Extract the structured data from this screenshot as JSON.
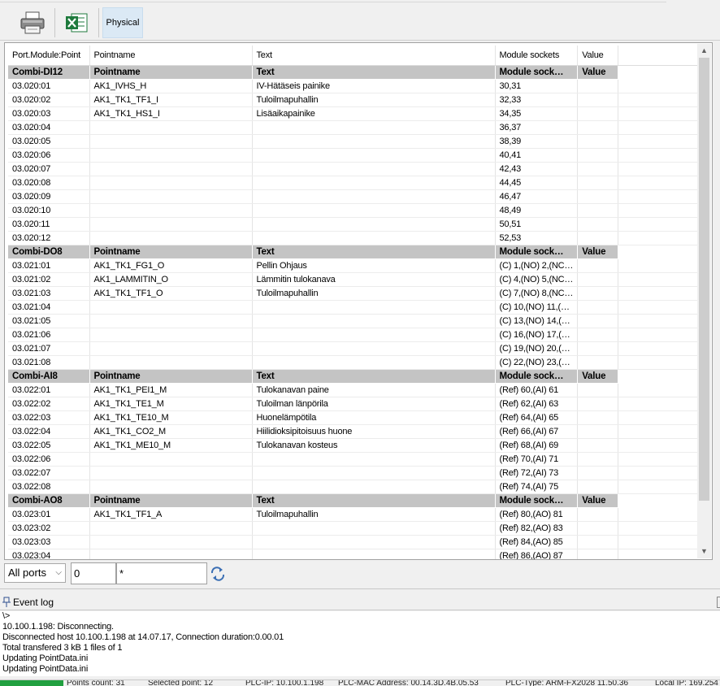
{
  "toolbar": {
    "physical_label": "Physical"
  },
  "grid": {
    "headers": [
      "Port.Module:Point",
      "Pointname",
      "Text",
      "Module sockets",
      "Value"
    ],
    "rows": [
      {
        "g": 1,
        "c": [
          "Combi-DI12",
          "Pointname",
          "Text",
          "Module sock…",
          "Value"
        ]
      },
      {
        "c": [
          "03.020:01",
          "AK1_IVHS_H",
          "IV-Hätäseis painike",
          "30,31",
          ""
        ]
      },
      {
        "c": [
          "03.020:02",
          "AK1_TK1_TF1_I",
          "Tuloilmapuhallin",
          "32,33",
          ""
        ]
      },
      {
        "c": [
          "03.020:03",
          "AK1_TK1_HS1_I",
          "Lisäaikapainike",
          "34,35",
          ""
        ]
      },
      {
        "c": [
          "03.020:04",
          "",
          "",
          "36,37",
          ""
        ]
      },
      {
        "c": [
          "03.020:05",
          "",
          "",
          "38,39",
          ""
        ]
      },
      {
        "c": [
          "03.020:06",
          "",
          "",
          "40,41",
          ""
        ]
      },
      {
        "c": [
          "03.020:07",
          "",
          "",
          "42,43",
          ""
        ]
      },
      {
        "c": [
          "03.020:08",
          "",
          "",
          "44,45",
          ""
        ]
      },
      {
        "c": [
          "03.020:09",
          "",
          "",
          "46,47",
          ""
        ]
      },
      {
        "c": [
          "03.020:10",
          "",
          "",
          "48,49",
          ""
        ]
      },
      {
        "c": [
          "03.020:11",
          "",
          "",
          "50,51",
          ""
        ]
      },
      {
        "c": [
          "03.020:12",
          "",
          "",
          "52,53",
          ""
        ]
      },
      {
        "g": 1,
        "c": [
          "Combi-DO8",
          "Pointname",
          "Text",
          "Module sock…",
          "Value"
        ]
      },
      {
        "c": [
          "03.021:01",
          "AK1_TK1_FG1_O",
          "Pellin Ohjaus",
          "(C) 1,(NO) 2,(NC…",
          ""
        ]
      },
      {
        "c": [
          "03.021:02",
          "AK1_LAMMITIN_O",
          "Lämmitin tulokanava",
          "(C) 4,(NO) 5,(NC…",
          ""
        ]
      },
      {
        "c": [
          "03.021:03",
          "AK1_TK1_TF1_O",
          "Tuloilmapuhallin",
          "(C) 7,(NO) 8,(NC…",
          ""
        ]
      },
      {
        "c": [
          "03.021:04",
          "",
          "",
          "(C) 10,(NO) 11,(…",
          ""
        ]
      },
      {
        "c": [
          "03.021:05",
          "",
          "",
          "(C) 13,(NO) 14,(…",
          ""
        ]
      },
      {
        "c": [
          "03.021:06",
          "",
          "",
          "(C) 16,(NO) 17,(…",
          ""
        ]
      },
      {
        "c": [
          "03.021:07",
          "",
          "",
          "(C) 19,(NO) 20,(…",
          ""
        ]
      },
      {
        "c": [
          "03.021:08",
          "",
          "",
          "(C) 22,(NO) 23,(…",
          ""
        ]
      },
      {
        "g": 1,
        "c": [
          "Combi-AI8",
          "Pointname",
          "Text",
          "Module sock…",
          "Value"
        ]
      },
      {
        "c": [
          "03.022:01",
          "AK1_TK1_PEI1_M",
          "Tulokanavan paine",
          "(Ref) 60,(AI) 61",
          ""
        ]
      },
      {
        "c": [
          "03.022:02",
          "AK1_TK1_TE1_M",
          "Tuloilman länpörila",
          "(Ref) 62,(AI) 63",
          ""
        ]
      },
      {
        "c": [
          "03.022:03",
          "AK1_TK1_TE10_M",
          "Huonelämpötila",
          "(Ref) 64,(AI) 65",
          ""
        ]
      },
      {
        "c": [
          "03.022:04",
          "AK1_TK1_CO2_M",
          "Hiilidioksipitoisuus huone",
          "(Ref) 66,(AI) 67",
          ""
        ]
      },
      {
        "c": [
          "03.022:05",
          "AK1_TK1_ME10_M",
          "Tulokanavan kosteus",
          "(Ref) 68,(AI) 69",
          ""
        ]
      },
      {
        "c": [
          "03.022:06",
          "",
          "",
          "(Ref) 70,(AI) 71",
          ""
        ]
      },
      {
        "c": [
          "03.022:07",
          "",
          "",
          "(Ref) 72,(AI) 73",
          ""
        ]
      },
      {
        "c": [
          "03.022:08",
          "",
          "",
          "(Ref) 74,(AI) 75",
          ""
        ]
      },
      {
        "g": 1,
        "c": [
          "Combi-AO8",
          "Pointname",
          "Text",
          "Module sock…",
          "Value"
        ]
      },
      {
        "c": [
          "03.023:01",
          "AK1_TK1_TF1_A",
          "Tuloilmapuhallin",
          "(Ref) 80,(AO) 81",
          ""
        ]
      },
      {
        "c": [
          "03.023:02",
          "",
          "",
          "(Ref) 82,(AO) 83",
          ""
        ]
      },
      {
        "c": [
          "03.023:03",
          "",
          "",
          "(Ref) 84,(AO) 85",
          ""
        ]
      },
      {
        "c": [
          "03.023:04",
          "",
          "",
          "(Ref) 86,(AO) 87",
          ""
        ]
      }
    ]
  },
  "filter": {
    "port_select": "All ports",
    "number_value": "0",
    "pattern_value": "*"
  },
  "eventlog": {
    "title": "Event log",
    "lines": [
      "\\>",
      "10.100.1.198: Disconnecting.",
      "Disconnected host 10.100.1.198 at 14.07.17, Connection duration:0.00.01",
      "Total transfered 3 kB 1 files of 1",
      "Updating  PointData.ini",
      "Updating  PointData.ini"
    ]
  },
  "status": {
    "items": [
      "Points count: 31",
      "Selected point: 12",
      "PLC-IP: 10.100.1.198",
      "PLC-MAC Address: 00.14.3D.4B.05.53",
      "PLC-Type: ARM-FX2028 11.50.36",
      "Local IP: 169.254"
    ]
  }
}
